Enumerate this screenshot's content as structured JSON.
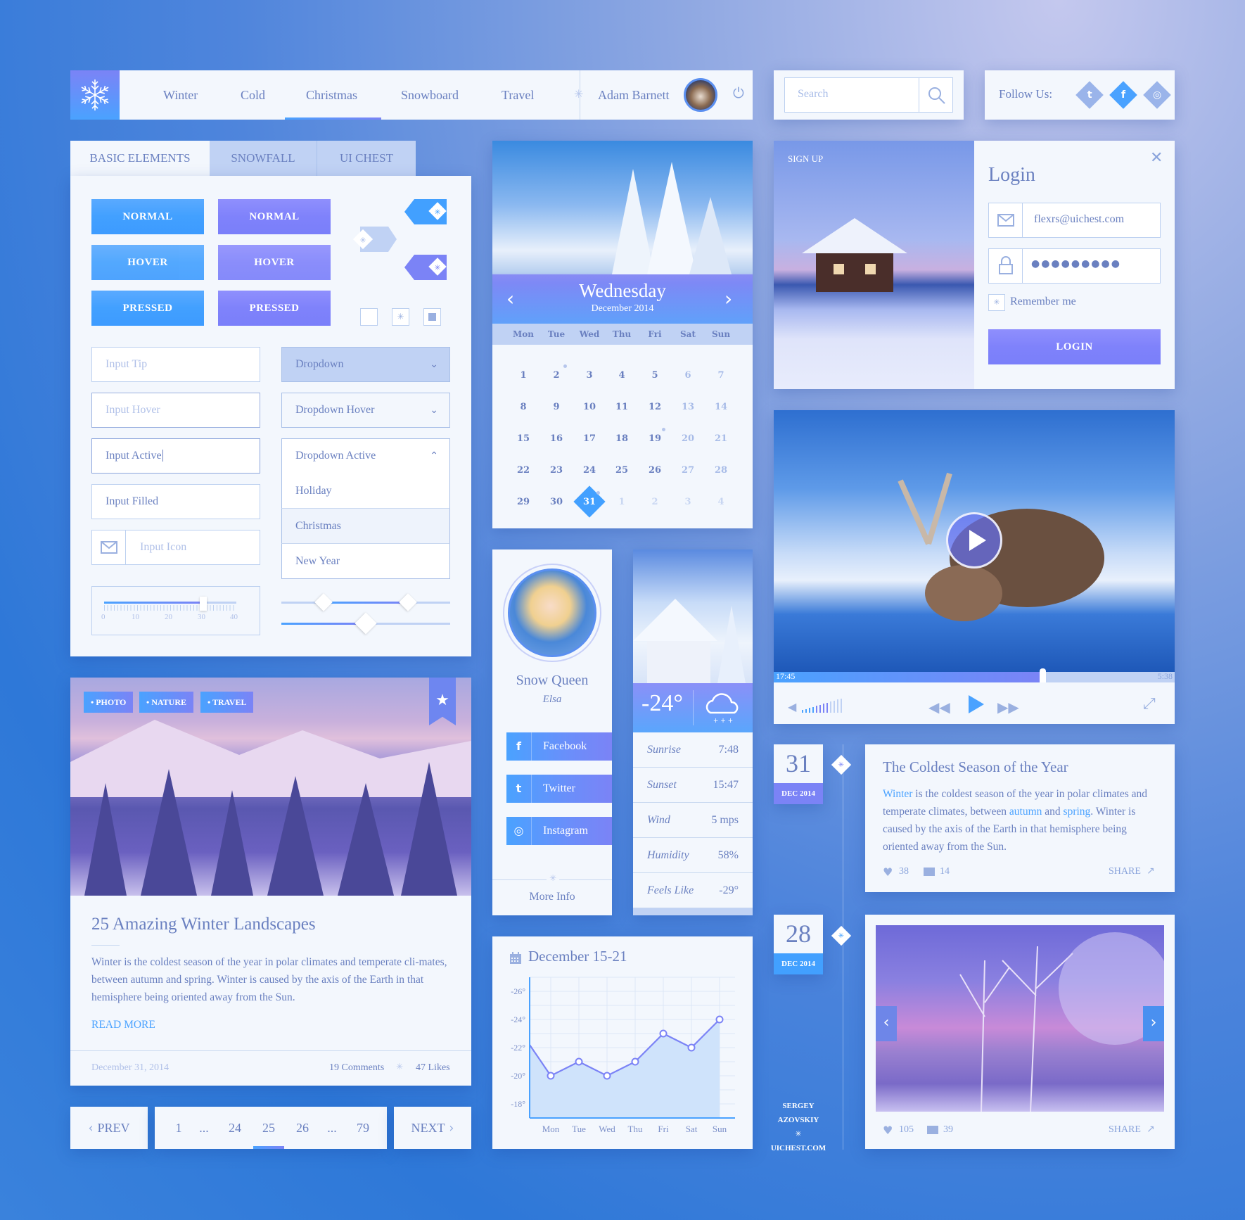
{
  "nav": {
    "logo_icon": "snowflake-icon",
    "items": [
      "Winter",
      "Cold",
      "Christmas",
      "Snowboard",
      "Travel"
    ],
    "active_index": 2,
    "user_name": "Adam Barnett",
    "power_icon": "power-icon"
  },
  "search": {
    "placeholder": "Search",
    "icon": "search-icon"
  },
  "follow": {
    "label": "Follow Us:",
    "icons": [
      "twitter-icon",
      "facebook-icon",
      "instagram-icon"
    ],
    "glyphs": [
      "t",
      "f",
      "◎"
    ]
  },
  "tabs": [
    {
      "label": "BASIC ELEMENTS",
      "active": true
    },
    {
      "label": "SNOWFALL",
      "active": false
    },
    {
      "label": "UI CHEST",
      "active": false
    }
  ],
  "buttons": {
    "blue": [
      "NORMAL",
      "HOVER",
      "PRESSED"
    ],
    "purple": [
      "NORMAL",
      "HOVER",
      "PRESSED"
    ]
  },
  "inputs": [
    {
      "label": "Input Tip",
      "state": "placeholder"
    },
    {
      "label": "Input Hover",
      "state": "hover"
    },
    {
      "label": "Input Active",
      "state": "active"
    },
    {
      "label": "Input Filled",
      "state": "filled"
    },
    {
      "label": "Input Icon",
      "state": "icon"
    }
  ],
  "dropdowns": {
    "normal": "Dropdown",
    "hover": "Dropdown Hover",
    "active": "Dropdown Active",
    "options": [
      "Holiday",
      "Christmas",
      "New Year"
    ]
  },
  "range_slider": {
    "ticks": [
      "0",
      "10",
      "20",
      "30",
      "40"
    ],
    "value": 30,
    "min": 0,
    "max": 40
  },
  "dual_slider": {
    "low": 0.25,
    "high": 0.75
  },
  "single_slider": {
    "value": 0.5
  },
  "calendar": {
    "weekday": "Wednesday",
    "month": "December 2014",
    "headers": [
      "Mon",
      "Tue",
      "Wed",
      "Thu",
      "Fri",
      "Sat",
      "Sun"
    ],
    "weeks": [
      [
        "1",
        "2",
        "3",
        "4",
        "5",
        "6",
        "7"
      ],
      [
        "8",
        "9",
        "10",
        "11",
        "12",
        "13",
        "14"
      ],
      [
        "15",
        "16",
        "17",
        "18",
        "19",
        "20",
        "21"
      ],
      [
        "22",
        "23",
        "24",
        "25",
        "26",
        "27",
        "28"
      ],
      [
        "29",
        "30",
        "31",
        "1",
        "2",
        "3",
        "4"
      ]
    ],
    "selected": "31",
    "event_days": [
      "2",
      "19",
      "31"
    ]
  },
  "login": {
    "signup_label": "SIGN UP",
    "title": "Login",
    "email": "flexrs@uichest.com",
    "password": "●●●●●●●●●",
    "remember": "Remember me",
    "button": "LOGIN",
    "close_icon": "close-icon"
  },
  "video": {
    "current_time": "17:45",
    "duration": "5:38",
    "progress": 0.67,
    "volume": 0.6
  },
  "profile": {
    "name": "Snow Queen",
    "subtitle": "Elsa",
    "socials": [
      {
        "label": "Facebook",
        "icon": "facebook-icon",
        "glyph": "f"
      },
      {
        "label": "Twitter",
        "icon": "twitter-icon",
        "glyph": "t"
      },
      {
        "label": "Instagram",
        "icon": "instagram-icon",
        "glyph": "◎"
      }
    ],
    "more": "More Info"
  },
  "weather": {
    "temp": "-24°",
    "icon": "snow-cloud-icon",
    "rows": [
      {
        "k": "Sunrise",
        "v": "7:48"
      },
      {
        "k": "Sunset",
        "v": "15:47"
      },
      {
        "k": "Wind",
        "v": "5 mps"
      },
      {
        "k": "Humidity",
        "v": "58%"
      },
      {
        "k": "Feels Like",
        "v": "-29°"
      }
    ]
  },
  "timeline": [
    {
      "day": "31",
      "month": "DEC 2014",
      "title": "The Coldest Season of the Year",
      "body_parts": [
        {
          "t": "Winter",
          "link": true
        },
        {
          "t": " is the coldest season of the year in polar climates and temperate climates, between ",
          "link": false
        },
        {
          "t": "autumn",
          "link": true
        },
        {
          "t": " and ",
          "link": false
        },
        {
          "t": "spring",
          "link": true
        },
        {
          "t": ". Winter is caused by the axis of the Earth in that hemisphere being oriented away from the Sun.",
          "link": false
        }
      ],
      "likes": "38",
      "comments": "14",
      "share": "SHARE"
    },
    {
      "day": "28",
      "month": "DEC 2014",
      "likes": "105",
      "comments": "39",
      "share": "SHARE"
    }
  ],
  "credits": {
    "line1": "SERGEY",
    "line2": "AZOVSKIY",
    "line3": "UICHEST.COM"
  },
  "article": {
    "tags": [
      "• PHOTO",
      "• NATURE",
      "• TRAVEL"
    ],
    "title": "25 Amazing Winter Landscapes",
    "body": "Winter is the coldest season of the year in polar climates and temperate cli-mates, between autumn and spring. Winter is caused by the axis of the Earth in that hemisphere being oriented away from the Sun.",
    "read_more": "READ MORE",
    "date": "December 31, 2014",
    "comments": "19 Comments",
    "likes": "47 Likes"
  },
  "pagination": {
    "prev": "PREV",
    "next": "NEXT",
    "pages": [
      "1",
      "...",
      "24",
      "25",
      "26",
      "...",
      "79"
    ],
    "current": "25"
  },
  "chart_data": {
    "type": "area",
    "title": "December 15-21",
    "categories": [
      "Mon",
      "Tue",
      "Wed",
      "Thu",
      "Fri",
      "Sat",
      "Sun"
    ],
    "values": [
      -20,
      -21,
      -20,
      -21,
      -23,
      -22,
      -24
    ],
    "start_value": -22.2,
    "yticks": [
      "-26°",
      "-24°",
      "-22°",
      "-20°",
      "-18°"
    ],
    "ylim": [
      -17,
      -27
    ],
    "grid": true,
    "colors": {
      "line": "#7b83f6",
      "fill": "#cfe3fb",
      "axis": "#4aa2ff"
    }
  }
}
